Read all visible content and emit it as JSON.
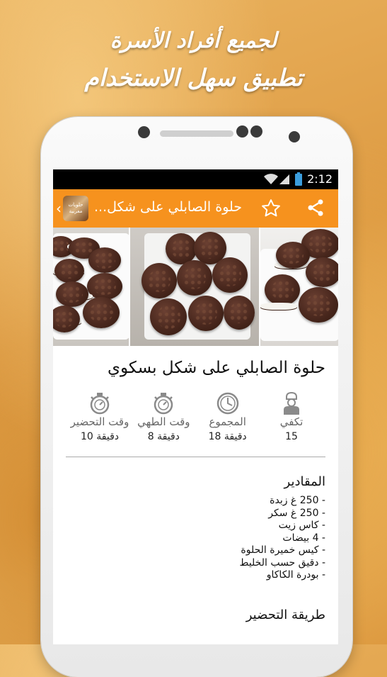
{
  "promo": {
    "line1": "لجميع أفراد الأسرة",
    "line2": "تطبيق سهل الاستخدام"
  },
  "statusbar": {
    "time": "2:12"
  },
  "appbar": {
    "title": "حلوة الصابلي على شكل...",
    "logo_text": "حلويات مغربية",
    "back_icon": "chevron-left-icon",
    "star_icon": "star-outline-icon",
    "share_icon": "share-icon"
  },
  "recipe": {
    "title": "حلوة الصابلي على شكل بسكوي",
    "stats": [
      {
        "icon": "chef-icon",
        "label": "تكفي",
        "value": "15"
      },
      {
        "icon": "clock-icon",
        "label": "المجموع",
        "value": "18 دقيقة"
      },
      {
        "icon": "stopwatch-icon",
        "label": "وقت الطهي",
        "value": "8 دقيقة"
      },
      {
        "icon": "stopwatch-icon",
        "label": "وقت التحضير",
        "value": "10 دقيقة"
      }
    ],
    "ingredients_heading": "المقادير",
    "ingredients": [
      "- 250 غ زبدة",
      "- 250 غ سكر",
      "- كاس زيت",
      "- 4 بيضات",
      "- كيس خميرة الحلوة",
      "- دقيق حسب الخليط",
      "- بودرة الكاكاو"
    ],
    "method_heading": "طريقة التحضير"
  },
  "colors": {
    "accent": "#f6921e",
    "statusbar": "#000000"
  }
}
